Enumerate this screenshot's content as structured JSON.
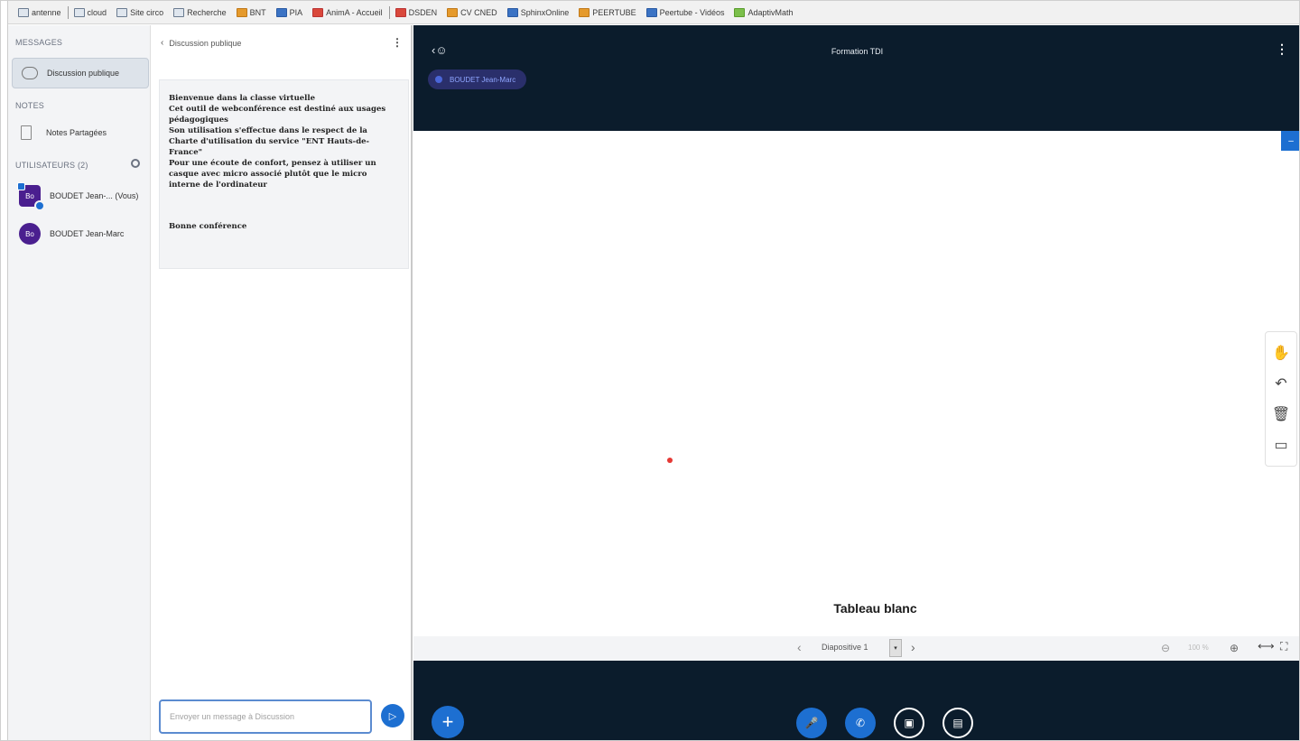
{
  "bookmarks": [
    {
      "label": "antenne",
      "icon": "folder-icon"
    },
    {
      "label": "cloud",
      "icon": "folder-icon"
    },
    {
      "label": "Site circo",
      "icon": "folder-icon"
    },
    {
      "label": "Recherche",
      "icon": "folder-icon"
    },
    {
      "label": "BNT",
      "icon": "site-icon"
    },
    {
      "label": "PIA",
      "icon": "site-icon"
    },
    {
      "label": "AnimA - Accueil",
      "icon": "site-icon"
    },
    {
      "label": "DSDEN",
      "icon": "site-icon"
    },
    {
      "label": "CV CNED",
      "icon": "site-icon"
    },
    {
      "label": "SphinxOnline",
      "icon": "site-icon"
    },
    {
      "label": "PEERTUBE",
      "icon": "site-icon"
    },
    {
      "label": "Peertube - Vidéos",
      "icon": "site-icon"
    },
    {
      "label": "AdaptivMath",
      "icon": "site-icon"
    }
  ],
  "sidebar": {
    "messages_heading": "MESSAGES",
    "chat_item": "Discussion publique",
    "notes_heading": "NOTES",
    "notes_item": "Notes Partagées",
    "users_heading": "UTILISATEURS (2)",
    "users": [
      {
        "initials": "Bo",
        "name": "BOUDET Jean-... (Vous)"
      },
      {
        "initials": "Bo",
        "name": "BOUDET Jean-Marc"
      }
    ]
  },
  "chat": {
    "title": "Discussion publique",
    "welcome_lines": [
      "Bienvenue dans la classe virtuelle",
      "Cet outil de webconférence est destiné aux usages pédagogiques",
      "Son utilisation s'effectue dans le respect de la Charte d'utilisation du service \"ENT Hauts-de-France\"",
      "Pour une écoute de confort, pensez à utiliser un casque avec micro associé plutôt que le micro interne de l'ordinateur"
    ],
    "welcome_bye": "Bonne conférence",
    "input_placeholder": "Envoyer un message à Discussion"
  },
  "presentation": {
    "meeting_title": "Formation TDI",
    "talking_user": "BOUDET Jean-Marc",
    "slide_caption": "Tableau blanc",
    "slide_label": "Diapositive 1",
    "zoom_label": "100 %",
    "tools": [
      "hand-icon",
      "undo-icon",
      "trash-icon",
      "whiteboard-icon"
    ]
  },
  "colors": {
    "header_bg": "#0b1c2c",
    "accent_blue": "#1d6fd1",
    "avatar_purple": "#4a1f8f",
    "panel_bg": "#f3f4f6"
  }
}
